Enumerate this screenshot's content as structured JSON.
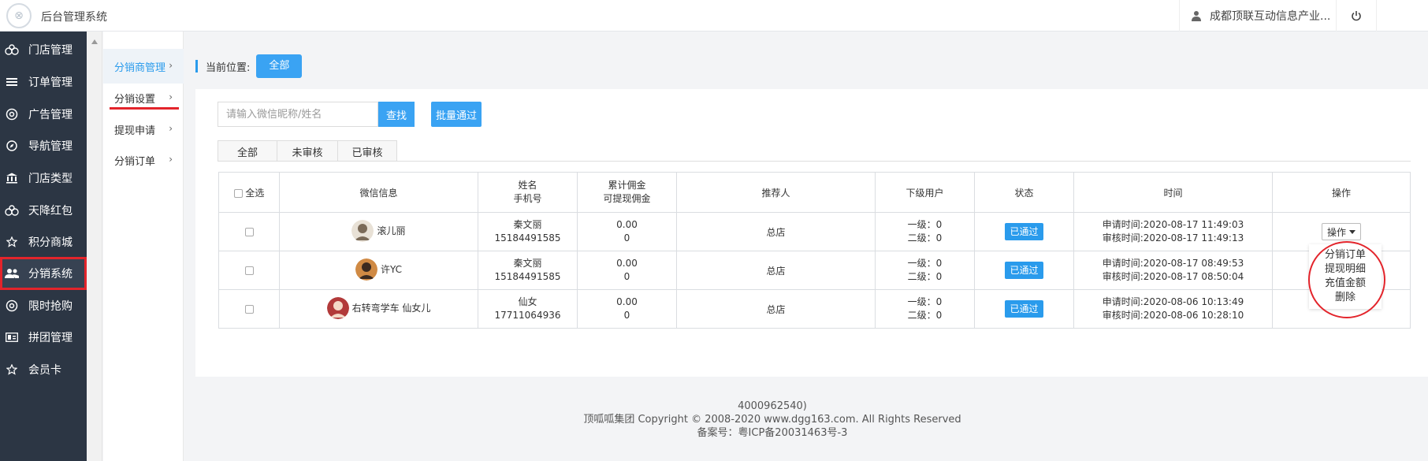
{
  "app": {
    "title": "后台管理系统",
    "user_name": "成都顶联互动信息产业..."
  },
  "leftnav": {
    "items": [
      {
        "label": "门店管理",
        "icon": "store-icon"
      },
      {
        "label": "订单管理",
        "icon": "list-icon"
      },
      {
        "label": "广告管理",
        "icon": "ad-icon"
      },
      {
        "label": "导航管理",
        "icon": "compass-icon"
      },
      {
        "label": "门店类型",
        "icon": "bank-icon"
      },
      {
        "label": "天降红包",
        "icon": "redpacket-icon"
      },
      {
        "label": "积分商城",
        "icon": "star-icon"
      },
      {
        "label": "分销系统",
        "icon": "users-icon"
      },
      {
        "label": "限时抢购",
        "icon": "clock-icon"
      },
      {
        "label": "拼团管理",
        "icon": "group-icon"
      },
      {
        "label": "会员卡",
        "icon": "star-icon"
      }
    ],
    "active": "分销系统"
  },
  "subnav": {
    "items": [
      {
        "label": "分销商管理"
      },
      {
        "label": "分销设置"
      },
      {
        "label": "提现申请"
      },
      {
        "label": "分销订单"
      }
    ],
    "active": "分销商管理"
  },
  "breadcrumb": {
    "label": "当前位置:",
    "current": "全部"
  },
  "search": {
    "placeholder": "请输入微信昵称/姓名",
    "button": "查找",
    "batch_button": "批量通过"
  },
  "tabs": [
    "全部",
    "未审核",
    "已审核"
  ],
  "table": {
    "headers": {
      "select_all": "全选",
      "wechat": "微信信息",
      "name_line1": "姓名",
      "name_line2": "手机号",
      "commission_line1": "累计佣金",
      "commission_line2": "可提现佣金",
      "referrer": "推荐人",
      "subordinates": "下级用户",
      "status": "状态",
      "time": "时间",
      "action": "操作"
    },
    "rows": [
      {
        "nickname": "滚儿丽",
        "name": "秦文丽",
        "phone": "15184491585",
        "total_commission": "0.00",
        "withdrawable": "0",
        "referrer": "总店",
        "level1": "一级：0",
        "level2": "二级：0",
        "status": "已通过",
        "apply_time": "申请时间:2020-08-17 11:49:03",
        "review_time": "审核时间:2020-08-17 11:49:13",
        "action": "操作"
      },
      {
        "nickname": "许YC",
        "name": "秦文丽",
        "phone": "15184491585",
        "total_commission": "0.00",
        "withdrawable": "0",
        "referrer": "总店",
        "level1": "一级：0",
        "level2": "二级：0",
        "status": "已通过",
        "apply_time": "申请时间:2020-08-17 08:49:53",
        "review_time": "审核时间:2020-08-17 08:50:04",
        "action": "操作"
      },
      {
        "nickname": "右转弯学车 仙女儿",
        "name": "仙女",
        "phone": "17711064936",
        "total_commission": "0.00",
        "withdrawable": "0",
        "referrer": "总店",
        "level1": "一级：0",
        "level2": "二级：0",
        "status": "已通过",
        "apply_time": "申请时间:2020-08-06 10:13:49",
        "review_time": "审核时间:2020-08-06 10:28:10",
        "action": "操作"
      }
    ]
  },
  "dropdown": {
    "items": [
      "分销订单",
      "提现明细",
      "充值金额",
      "删除"
    ]
  },
  "footer": {
    "line1": "4000962540)",
    "line2": "顶呱呱集团 Copyright © 2008-2020 www.dgg163.com. All Rights Reserved",
    "line3": "备案号：粤ICP备20031463号-3"
  },
  "colors": {
    "accent": "#3aa3f3",
    "nav_bg": "#2c3644",
    "highlight": "#e3242b"
  }
}
